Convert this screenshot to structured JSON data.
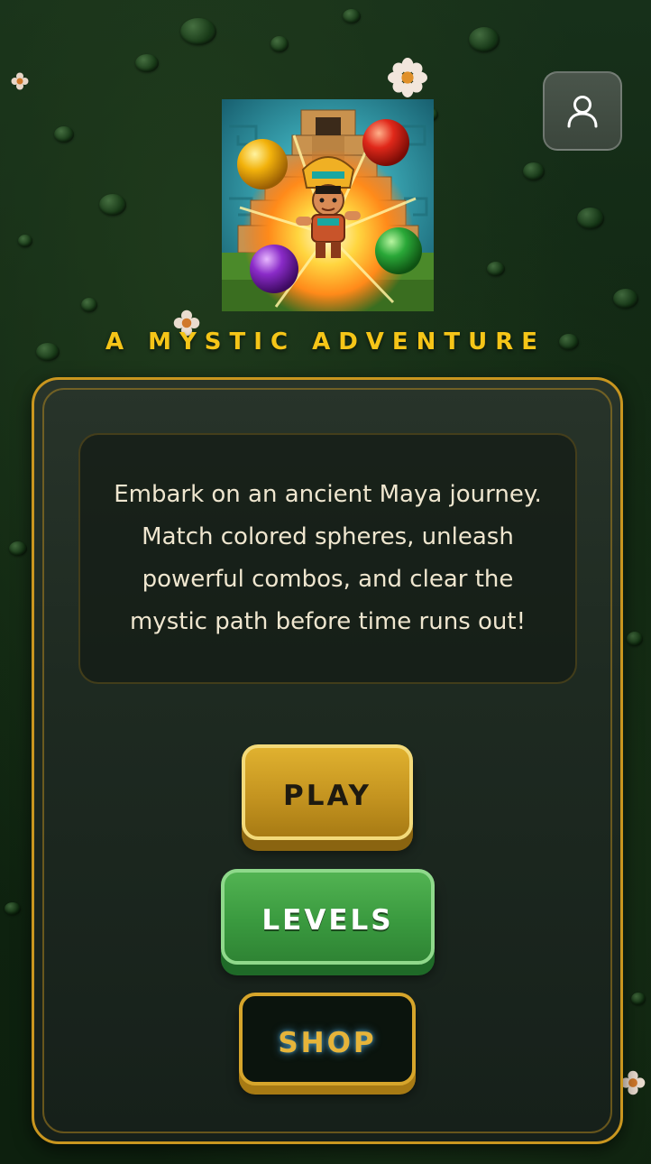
{
  "header": {
    "profile_icon": "user-icon"
  },
  "art": {
    "icon": "maya-temple-hero-art"
  },
  "tagline": "A MYSTIC ADVENTURE",
  "description": "Embark on an ancient Maya journey. Match colored spheres, unleash powerful combos, and clear the mystic path before time runs out!",
  "buttons": {
    "play": "PLAY",
    "levels": "LEVELS",
    "shop": "SHOP"
  },
  "colors": {
    "accent_gold": "#f5c518",
    "panel_border": "#c9961f",
    "play": "#c49420",
    "levels": "#3a9a3f",
    "shop": "#0b140d"
  }
}
